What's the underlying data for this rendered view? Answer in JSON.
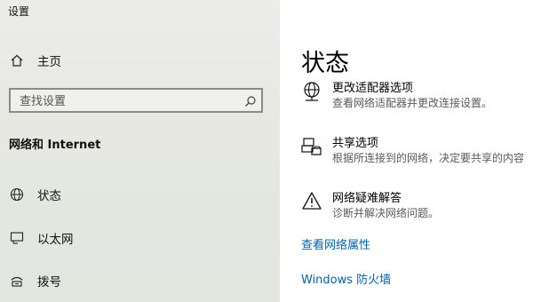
{
  "window": {
    "title": "设置"
  },
  "sidebar": {
    "home_label": "主页",
    "search_placeholder": "查找设置",
    "section_header": "网络和 Internet",
    "items": [
      {
        "label": "状态",
        "icon": "home-globe-icon"
      },
      {
        "label": "以太网",
        "icon": "ethernet-icon"
      },
      {
        "label": "拨号",
        "icon": "dialup-icon"
      }
    ]
  },
  "main": {
    "title": "状态",
    "options": [
      {
        "title": "更改适配器选项",
        "desc": "查看网络适配器并更改连接设置。",
        "icon": "adapter-globe-icon"
      },
      {
        "title": "共享选项",
        "desc": "根据所连接到的网络，决定要共享的内容",
        "icon": "sharing-icon"
      },
      {
        "title": "网络疑难解答",
        "desc": "诊断并解决网络问题。",
        "icon": "warning-icon"
      }
    ],
    "links": [
      {
        "label": "查看网络属性"
      },
      {
        "label": "Windows 防火墙"
      }
    ]
  },
  "colors": {
    "link": "#0063b1",
    "sidebar_bg": "#e6e8e1",
    "main_bg": "#ffffff"
  }
}
